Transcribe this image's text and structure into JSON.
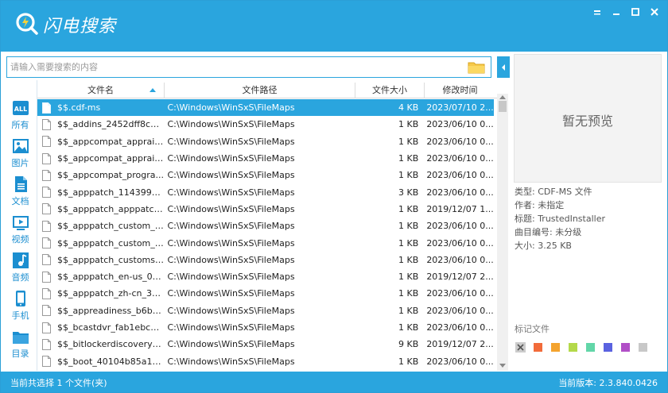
{
  "app": {
    "title": "闪电搜索",
    "window_controls": [
      "minimize-icon",
      "restore-icon",
      "maximize-icon",
      "close-icon"
    ]
  },
  "search": {
    "placeholder": "请输入需要搜索的内容",
    "value": "",
    "browse_icon": "folder-icon"
  },
  "sidebar": {
    "items": [
      {
        "label": "所有",
        "icon": "all-icon",
        "active": true
      },
      {
        "label": "图片",
        "icon": "image-icon"
      },
      {
        "label": "文档",
        "icon": "document-icon"
      },
      {
        "label": "视频",
        "icon": "video-icon"
      },
      {
        "label": "音频",
        "icon": "audio-icon"
      },
      {
        "label": "手机",
        "icon": "phone-icon"
      },
      {
        "label": "目录",
        "icon": "folder-icon"
      }
    ]
  },
  "table": {
    "columns": [
      "文件名",
      "文件路径",
      "文件大小",
      "修改时间"
    ],
    "rows": [
      {
        "name": "$$.cdf-ms",
        "path": "C:\\Windows\\WinSxS\\FileMaps",
        "size": "4 KB",
        "modified": "2023/07/10 2...",
        "selected": true
      },
      {
        "name": "$$_addins_2452dff8cb6...",
        "path": "C:\\Windows\\WinSxS\\FileMaps",
        "size": "1 KB",
        "modified": "2023/06/10 0..."
      },
      {
        "name": "$$_appcompat_apprais...",
        "path": "C:\\Windows\\WinSxS\\FileMaps",
        "size": "1 KB",
        "modified": "2023/06/10 0..."
      },
      {
        "name": "$$_appcompat_apprais...",
        "path": "C:\\Windows\\WinSxS\\FileMaps",
        "size": "1 KB",
        "modified": "2023/06/10 0..."
      },
      {
        "name": "$$_appcompat_progra...",
        "path": "C:\\Windows\\WinSxS\\FileMaps",
        "size": "1 KB",
        "modified": "2023/06/10 0..."
      },
      {
        "name": "$$_apppatch_1143992c...",
        "path": "C:\\Windows\\WinSxS\\FileMaps",
        "size": "3 KB",
        "modified": "2023/06/10 0..."
      },
      {
        "name": "$$_apppatch_apppatch...",
        "path": "C:\\Windows\\WinSxS\\FileMaps",
        "size": "1 KB",
        "modified": "2019/12/07 1..."
      },
      {
        "name": "$$_apppatch_custom_2...",
        "path": "C:\\Windows\\WinSxS\\FileMaps",
        "size": "1 KB",
        "modified": "2023/06/10 0..."
      },
      {
        "name": "$$_apppatch_custom_c...",
        "path": "C:\\Windows\\WinSxS\\FileMaps",
        "size": "1 KB",
        "modified": "2023/06/10 0..."
      },
      {
        "name": "$$_apppatch_customsd...",
        "path": "C:\\Windows\\WinSxS\\FileMaps",
        "size": "1 KB",
        "modified": "2023/06/10 0..."
      },
      {
        "name": "$$_apppatch_en-us_098...",
        "path": "C:\\Windows\\WinSxS\\FileMaps",
        "size": "1 KB",
        "modified": "2019/12/07 2..."
      },
      {
        "name": "$$_apppatch_zh-cn_317...",
        "path": "C:\\Windows\\WinSxS\\FileMaps",
        "size": "1 KB",
        "modified": "2023/06/10 0..."
      },
      {
        "name": "$$_appreadiness_b6ba...",
        "path": "C:\\Windows\\WinSxS\\FileMaps",
        "size": "1 KB",
        "modified": "2023/06/10 0..."
      },
      {
        "name": "$$_bcastdvr_fab1ebc0d...",
        "path": "C:\\Windows\\WinSxS\\FileMaps",
        "size": "1 KB",
        "modified": "2023/06/10 0..."
      },
      {
        "name": "$$_bitlockerdiscoveryv...",
        "path": "C:\\Windows\\WinSxS\\FileMaps",
        "size": "9 KB",
        "modified": "2019/12/07 2..."
      },
      {
        "name": "$$_boot_40104b85a18...",
        "path": "C:\\Windows\\WinSxS\\FileMaps",
        "size": "1 KB",
        "modified": "2023/06/10 0..."
      }
    ]
  },
  "preview": {
    "empty_text": "暂无预览",
    "meta": [
      "类型: CDF-MS 文件",
      "作者: 未指定",
      "标题: TrustedInstaller",
      "曲目编号: 未分级",
      "大小: 3.25 KB"
    ]
  },
  "tags": {
    "title": "标记文件",
    "colors": [
      "#f26b3a",
      "#f4a32e",
      "#b4d94a",
      "#62d6a8",
      "#5a62e0",
      "#b14fc7",
      "#c8c8c8"
    ]
  },
  "status": {
    "left": "当前共选择 1 个文件(夹)",
    "right": "当前版本: 2.3.840.0426"
  },
  "theme": {
    "accent": "#2aa5de"
  }
}
